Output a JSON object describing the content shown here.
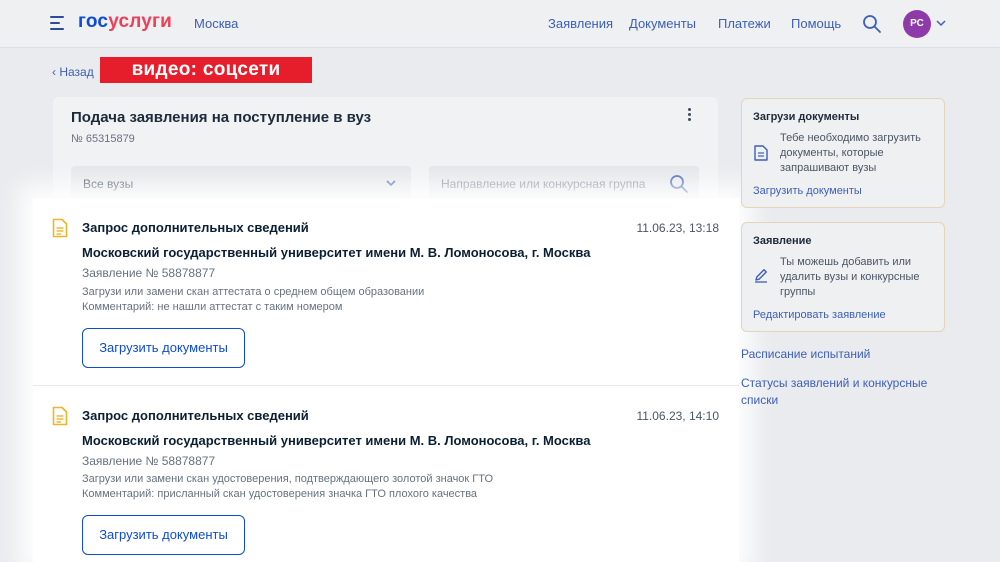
{
  "header": {
    "logo_part1": "гос",
    "logo_part2": "услуги",
    "city": "Москва",
    "nav": [
      "Заявления",
      "Документы",
      "Платежи",
      "Помощь"
    ],
    "avatar_initials": "РС"
  },
  "back_label": "‹ Назад",
  "banner_text": "видео: соцсети",
  "application": {
    "title": "Подача заявления на поступление в вуз",
    "number": "№ 65315879",
    "filter_select_value": "Все вузы",
    "search_placeholder": "Направление или конкурсная группа"
  },
  "requests": [
    {
      "title": "Запрос дополнительных сведений",
      "date": "11.06.23, 13:18",
      "university": "Московский государственный университет имени М. В. Ломоносова, г. Москва",
      "application_number": "Заявление № 58878877",
      "instruction": "Загрузи или замени скан аттестата о среднем общем образовании",
      "comment": "Комментарий: не нашли аттестат с таким номером",
      "button_label": "Загрузить документы"
    },
    {
      "title": "Запрос дополнительных сведений",
      "date": "11.06.23, 14:10",
      "university": "Московский государственный университет имени М. В. Ломоносова, г. Москва",
      "application_number": "Заявление № 58878877",
      "instruction": "Загрузи или замени скан удостоверения, подтверждающего золотой значок ГТО",
      "comment": "Комментарий: присланный скан удостоверения значка ГТО плохого качества",
      "button_label": "Загрузить документы"
    }
  ],
  "sidebar": {
    "upload_card": {
      "title": "Загрузи документы",
      "description": "Тебе необходимо загрузить документы, которые запрашивают вузы",
      "link": "Загрузить документы"
    },
    "application_card": {
      "title": "Заявление",
      "description": "Ты можешь добавить или удалить вузы и конкурсные группы",
      "link": "Редактировать заявление"
    },
    "links": [
      "Расписание испытаний",
      "Статусы заявлений и конкурсные списки"
    ]
  },
  "colors": {
    "accent": "#0d4cd3",
    "logo_red": "#ee3f58",
    "banner_red": "#e61d2b",
    "doc_icon_yellow": "#f0b429",
    "avatar_purple": "#8e3aa8"
  }
}
